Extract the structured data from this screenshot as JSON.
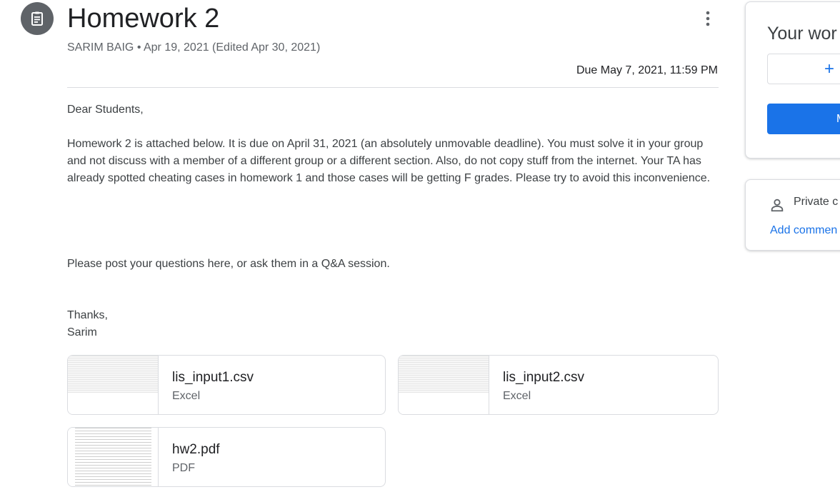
{
  "header": {
    "title": "Homework 2",
    "author": "SARIM BAIG",
    "separator": "•",
    "date": "Apr 19, 2021 (Edited Apr 30, 2021)",
    "due": "Due May 7, 2021, 11:59 PM",
    "type_icon": "assignment-icon",
    "more_icon": "more-vert-icon"
  },
  "body": {
    "greeting": "Dear Students,",
    "main": "Homework 2 is attached below. It is due on April 31, 2021 (an absolutely unmovable deadline). You must solve it in your group and not discuss with a member of a different group or a different section. Also, do not copy stuff from the internet. Your TA has already spotted cheating cases in homework 1 and those cases will be getting F grades. Please try to avoid this inconvenience.",
    "questions": "Please post your questions here, or ask them in a Q&A session.",
    "thanks": "Thanks,",
    "signature": "Sarim"
  },
  "attachments": [
    {
      "name": "lis_input1.csv",
      "type": "Excel"
    },
    {
      "name": "lis_input2.csv",
      "type": "Excel"
    },
    {
      "name": "hw2.pdf",
      "type": "PDF"
    }
  ],
  "your_work": {
    "title": "Your wor",
    "add_symbol": "+",
    "mark_button": "M"
  },
  "private_comments": {
    "label": "Private c",
    "add": "Add commen",
    "icon": "person-icon"
  },
  "colors": {
    "accent": "#1a73e8",
    "icon_bg": "#5f6368",
    "border": "#dadce0"
  }
}
